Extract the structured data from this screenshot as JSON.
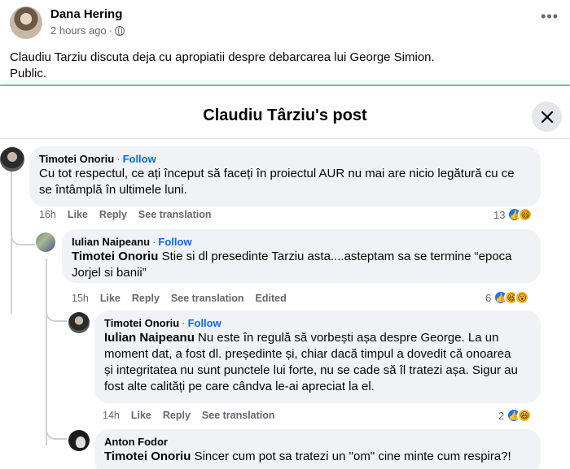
{
  "post": {
    "author": "Dana Hering",
    "time": "2 hours ago",
    "more_label": "•••",
    "text_line1": "Claudiu Tarziu discuta deja cu apropiatii despre debarcarea lui George Simion.",
    "text_line2": "Public."
  },
  "modal": {
    "title": "Claudiu Târziu's post"
  },
  "comments": [
    {
      "name": "Timotei Onoriu",
      "follow": "Follow",
      "line1": "Cu tot respectul, ce ați început să faceți în proiectul AUR nu mai are nicio legătură cu ce",
      "line2": "se întâmplă în ultimele luni.",
      "time": "16h",
      "like": "Like",
      "reply": "Reply",
      "translate": "See translation",
      "count": "13"
    },
    {
      "name": "Iulian Naipeanu",
      "follow": "Follow",
      "mention": "Timotei Onoriu",
      "line1": " Stie si dl presedinte Tarziu asta....asteptam sa se termine “epoca",
      "line2": "Jorjel si banii”",
      "time": "15h",
      "like": "Like",
      "reply": "Reply",
      "translate": "See translation",
      "edited": "Edited",
      "count": "6"
    },
    {
      "name": "Timotei Onoriu",
      "follow": "Follow",
      "mention": "Iulian Naipeanu",
      "line1": " Nu este în regulă să vorbești așa despre George. La un",
      "line2": "moment dat, a fost dl. președinte și, chiar dacă timpul a dovedit că onoarea",
      "line3": "și integritatea nu sunt punctele lui forte, nu se cade să îl tratezi așa. Sigur au",
      "line4": "fost alte calități pe care cândva le-ai apreciat la el.",
      "time": "14h",
      "like": "Like",
      "reply": "Reply",
      "translate": "See translation",
      "count": "2"
    },
    {
      "name": "Anton Fodor",
      "mention": "Timotei Onoriu",
      "line1": " Sincer cum pot sa tratezi un \"om\" cine minte cum respira?!"
    }
  ],
  "icons": {
    "close": "close-icon",
    "like": "like-reaction-icon",
    "haha": "haha-reaction-icon",
    "wow": "wow-reaction-icon",
    "globe": "globe-icon"
  }
}
